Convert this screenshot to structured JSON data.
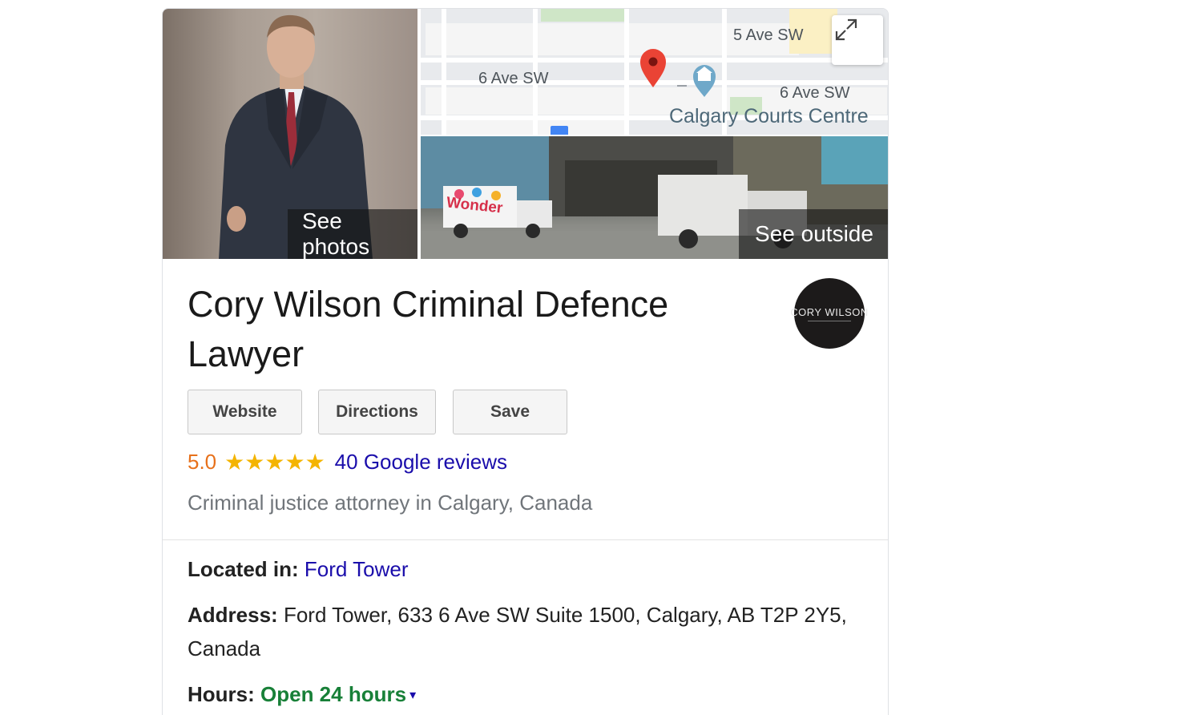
{
  "media": {
    "photos_label": "See photos",
    "outside_label": "See outside",
    "street_sign": "Wonder"
  },
  "map": {
    "labels": [
      "5 Ave SW",
      "6 Ave SW",
      "6 Ave SW",
      "Calgary Courts Centre"
    ],
    "pin_color": "#ea4335",
    "landmark_color": "#5b9bd5"
  },
  "business": {
    "name": "Cory Wilson Criminal Defence Lawyer",
    "logo_text": "CORY WILSON",
    "buttons": {
      "website": "Website",
      "directions": "Directions",
      "save": "Save"
    },
    "rating": "5.0",
    "stars": "★★★★★",
    "star_fraction": 1.0,
    "reviews_label": "40 Google reviews",
    "category": "Criminal justice attorney in Calgary, Canada"
  },
  "facts": {
    "located_in_key": "Located in:",
    "located_in_value": "Ford Tower",
    "address_key": "Address:",
    "address_value": "Ford Tower, 633 6 Ave SW Suite 1500, Calgary, AB T2P 2Y5, Canada",
    "hours_key": "Hours:",
    "hours_value": "Open 24 hours",
    "hours_caret": "▾"
  },
  "colors": {
    "link": "#1a0dab",
    "rating": "#e7711b",
    "star": "#f4b400",
    "open": "#188038"
  }
}
